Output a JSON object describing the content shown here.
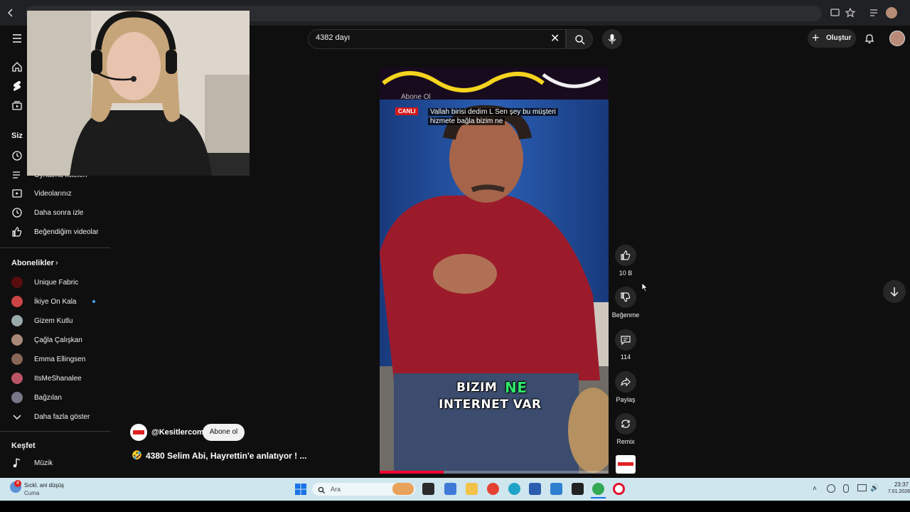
{
  "search": {
    "query": "4382 dayı"
  },
  "header": {
    "create_label": "Oluştur"
  },
  "sidebar": {
    "siz_title": "Siz",
    "items": [
      {
        "label": "Oynatma listeleri"
      },
      {
        "label": "Videolarınız"
      },
      {
        "label": "Daha sonra izle"
      },
      {
        "label": "Beğendiğim videolar"
      }
    ],
    "subscriptions_title": "Abonelikler",
    "subscriptions": [
      {
        "name": "Unique Fabric",
        "color": "#5a0d0d"
      },
      {
        "name": "İkiye On Kala",
        "color": "#c44"
      },
      {
        "name": "Gizem Kutlu",
        "color": "#9aa"
      },
      {
        "name": "Çağla Çalışkan",
        "color": "#a87"
      },
      {
        "name": "Emma Ellingsen",
        "color": "#865"
      },
      {
        "name": "ItsMeShanalee",
        "color": "#b56"
      },
      {
        "name": "Bağzılan",
        "color": "#778"
      }
    ],
    "show_more_label": "Daha fazla göster",
    "explore_title": "Keşfet",
    "explore_items": [
      {
        "label": "Müzik"
      }
    ]
  },
  "video": {
    "channel": "@Kesitlercom",
    "subscribe_label": "Abone ol",
    "title": "4380 Selim Abi, Hayrettin'e anlatıyor ! ...",
    "title_emoji": "🤣",
    "overlay_subscribe": "Abone Ol",
    "live_tag": "CANLI",
    "subtitle_line1": "Vallah birisi dedim L Sen şey bu müşteri",
    "subtitle_line2": "hizmete bağla bizim ne",
    "caption_word1": "BIZIM",
    "caption_word2": "NE",
    "caption_line2": "INTERNET VAR",
    "caption_highlight_color": "#2ee86a",
    "progress": 0.28
  },
  "actions": {
    "like_count": "10 B",
    "dislike_label": "Beğenme",
    "comment_count": "114",
    "share_label": "Paylaş",
    "remix_label": "Remix"
  },
  "taskbar": {
    "weather_badge": "4",
    "weather_title": "Sıckl. ani düşüş",
    "weather_sub": "Cuma",
    "search_placeholder": "Ara",
    "time": "23:37",
    "date": "7.01.2026"
  }
}
